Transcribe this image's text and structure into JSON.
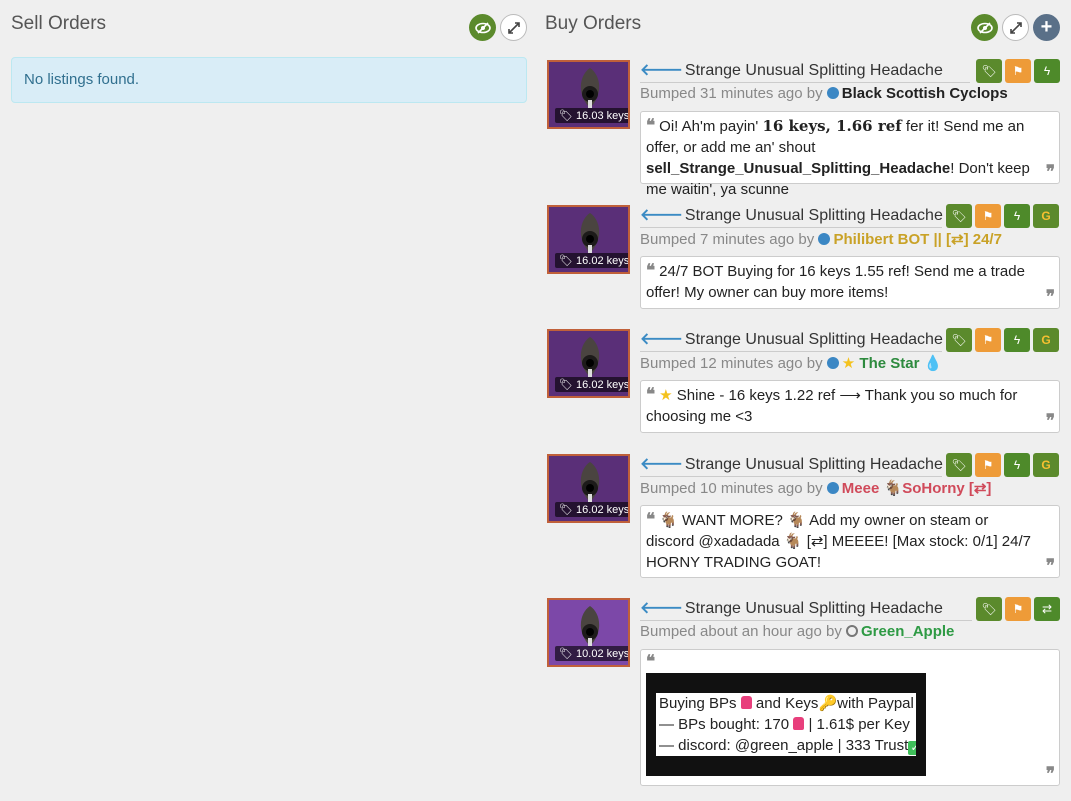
{
  "sell": {
    "title": "Sell Orders",
    "empty_text": "No listings found."
  },
  "buy": {
    "title": "Buy Orders",
    "listings": [
      {
        "title": "Strange Unusual Splitting Headache",
        "price": "16.03 keys",
        "bumped": "Bumped 31 minutes ago by",
        "user": "Black Scottish Cyclops",
        "msg_a": "Oi! Ah'm payin' ",
        "msg_b": "16 keys, 1.66 ref",
        "msg_c": " fer it! Send me an offer, or add me an' shout ",
        "msg_d": "sell_Strange_Unusual_Splitting_Headache",
        "msg_e": "! Don't keep me waitin', ya scunne"
      },
      {
        "title": "Strange Unusual Splitting Headache",
        "price": "16.02 keys",
        "bumped": "Bumped 7 minutes ago by",
        "user": "Philibert BOT || [⇄] 24/7",
        "msg": "24/7 BOT Buying for 16 keys 1.55 ref! Send me a trade offer! My owner can buy more items!"
      },
      {
        "title": "Strange Unusual Splitting Headache",
        "price": "16.02 keys",
        "bumped": "Bumped 12 minutes ago by",
        "user": "The Star",
        "msg": "Shine - 16 keys 1.22 ref ⟶ Thank you so much for choosing me <3"
      },
      {
        "title": "Strange Unusual Splitting Headache",
        "price": "16.02 keys",
        "bumped": "Bumped 10 minutes ago by",
        "user_a": "Meee",
        "user_b": "SoHorny [⇄]",
        "msg_a": "WANT MORE?",
        "msg_b": "Add my owner on steam or discord @xadadada",
        "msg_c": "[⇄] MEEEE! [Max stock: 0/1] 24/7 HORNY TRADING GOAT!"
      },
      {
        "title": "Strange Unusual Splitting Headache",
        "price": "10.02 keys",
        "bumped": "Bumped about an hour ago by",
        "user": "Green_Apple",
        "line1_a": "Buying BPs",
        "line1_b": "and Keys",
        "line1_c": "with Paypal",
        "line2_a": "— BPs bought: 170",
        "line2_b": "| 1.61$ per Key",
        "line3": "— discord: @green_apple | 333 Trust"
      }
    ]
  },
  "colors": {
    "accent_green": "#5b8a2c",
    "accent_orange": "#ee9b38",
    "link_blue": "#3b8bc4",
    "alert_bg": "#d9edf7"
  }
}
